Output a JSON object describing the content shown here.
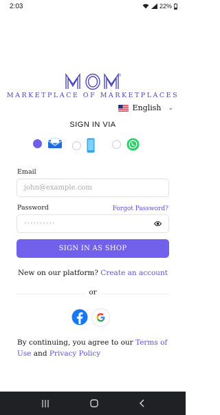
{
  "status_bar": {
    "time": "2:03",
    "battery": "22%"
  },
  "logo": {
    "brand": "MOM",
    "tagline": "MARKETPLACE OF MARKETPLACES",
    "brand_color": "#4b47b8"
  },
  "language": {
    "selected": "English"
  },
  "signin_via": "SIGN IN VIA",
  "methods": [
    {
      "name": "email",
      "icon": "envelope-icon",
      "selected": true
    },
    {
      "name": "phone",
      "icon": "phone-icon",
      "selected": false
    },
    {
      "name": "whatsapp",
      "icon": "whatsapp-icon",
      "selected": false
    }
  ],
  "form": {
    "email_label": "Email",
    "email_placeholder": "john@example.com",
    "password_label": "Password",
    "password_placeholder": "••••••••••",
    "forgot_label": "Forgot Password?",
    "submit_label": "SIGN IN AS SHOP"
  },
  "register": {
    "prompt": "New on our platform?",
    "link": "Create an account"
  },
  "or_label": "or",
  "terms": {
    "prefix": "By continuing, you agree to our",
    "terms_link": "Terms of Use",
    "and": "and",
    "privacy_link": "Privacy Policy"
  },
  "colors": {
    "accent": "#7060ea",
    "link": "#5b52d6"
  }
}
